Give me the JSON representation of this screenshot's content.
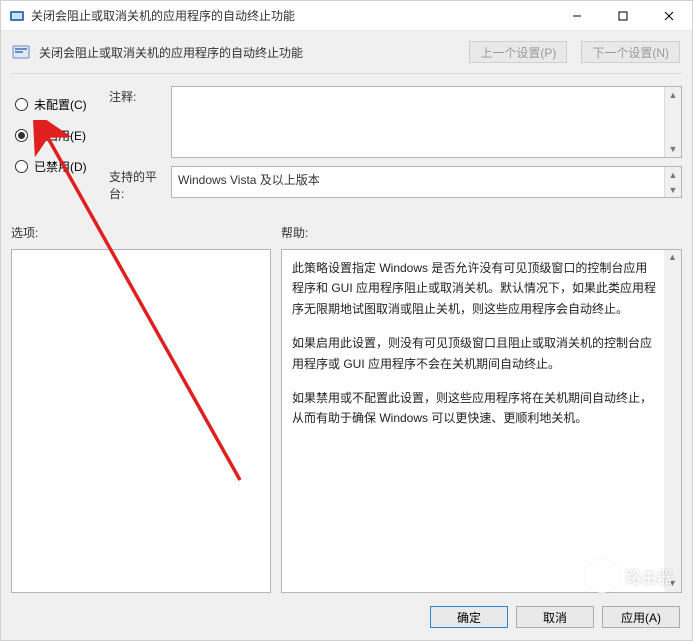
{
  "window": {
    "title": "关闭会阻止或取消关机的应用程序的自动终止功能"
  },
  "header": {
    "setting_title": "关闭会阻止或取消关机的应用程序的自动终止功能",
    "prev_label": "上一个设置(P)",
    "next_label": "下一个设置(N)"
  },
  "radios": {
    "not_configured": "未配置(C)",
    "enabled": "已启用(E)",
    "disabled": "已禁用(D)",
    "selected": "enabled"
  },
  "fields": {
    "notes_label": "注释:",
    "notes_value": "",
    "platform_label": "支持的平台:",
    "platform_value": "Windows Vista 及以上版本"
  },
  "sections": {
    "options_label": "选项:",
    "help_label": "帮助:"
  },
  "help": {
    "p1": "此策略设置指定 Windows 是否允许没有可见顶级窗口的控制台应用程序和 GUI 应用程序阻止或取消关机。默认情况下，如果此类应用程序无限期地试图取消或阻止关机，则这些应用程序会自动终止。",
    "p2": "如果启用此设置，则没有可见顶级窗口且阻止或取消关机的控制台应用程序或 GUI 应用程序不会在关机期间自动终止。",
    "p3": "如果禁用或不配置此设置，则这些应用程序将在关机期间自动终止，从而有助于确保 Windows 可以更快速、更顺利地关机。"
  },
  "footer": {
    "ok": "确定",
    "cancel": "取消",
    "apply": "应用(A)"
  },
  "watermark": {
    "text": "路由器",
    "sub": ""
  }
}
